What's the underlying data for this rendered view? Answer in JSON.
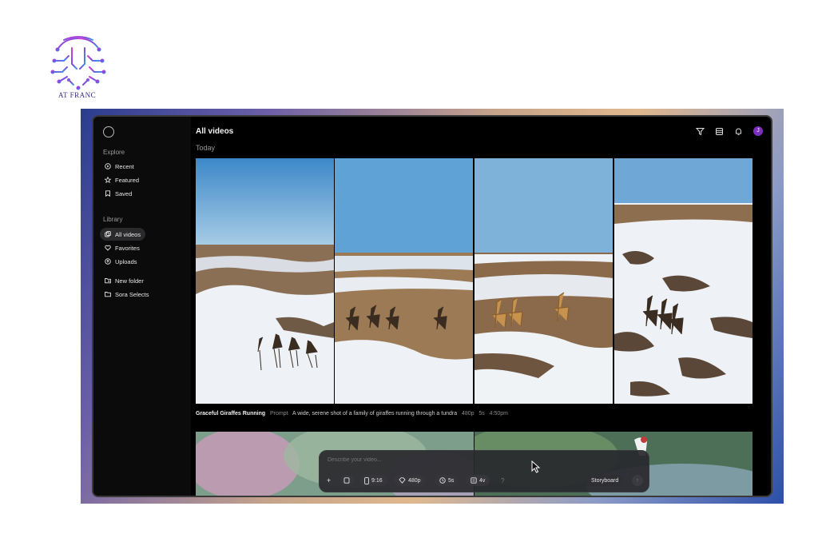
{
  "brand": {
    "logo_text": "AT FRANC"
  },
  "app": {
    "title": "All videos",
    "section": "Today"
  },
  "sidebar": {
    "explore_heading": "Explore",
    "explore_items": [
      {
        "label": "Recent",
        "icon": "play-circle-icon"
      },
      {
        "label": "Featured",
        "icon": "star-icon"
      },
      {
        "label": "Saved",
        "icon": "bookmark-icon"
      }
    ],
    "library_heading": "Library",
    "library_items": [
      {
        "label": "All videos",
        "icon": "videos-icon",
        "active": true
      },
      {
        "label": "Favorites",
        "icon": "heart-icon"
      },
      {
        "label": "Uploads",
        "icon": "upload-icon"
      }
    ],
    "folder_items": [
      {
        "label": "New folder",
        "icon": "new-folder-icon"
      },
      {
        "label": "Sora Selects",
        "icon": "folder-icon"
      }
    ]
  },
  "top_icons": [
    "filter-icon",
    "grid-view-icon",
    "bell-icon"
  ],
  "avatar": {
    "initial": "J",
    "color": "#7b2fbf"
  },
  "video": {
    "title": "Graceful Giraffes Running",
    "prompt_label": "Prompt",
    "prompt": "A wide, serene shot of a family of giraffes running through a tundra",
    "resolution": "480p",
    "duration": "5s",
    "time": "4:50pm"
  },
  "composer": {
    "placeholder": "Describe your video...",
    "add_label": "+",
    "aspect": "9:16",
    "resolution": "480p",
    "duration": "5s",
    "variations": "4v",
    "help": "?",
    "storyboard": "Storyboard",
    "submit": "↑"
  }
}
